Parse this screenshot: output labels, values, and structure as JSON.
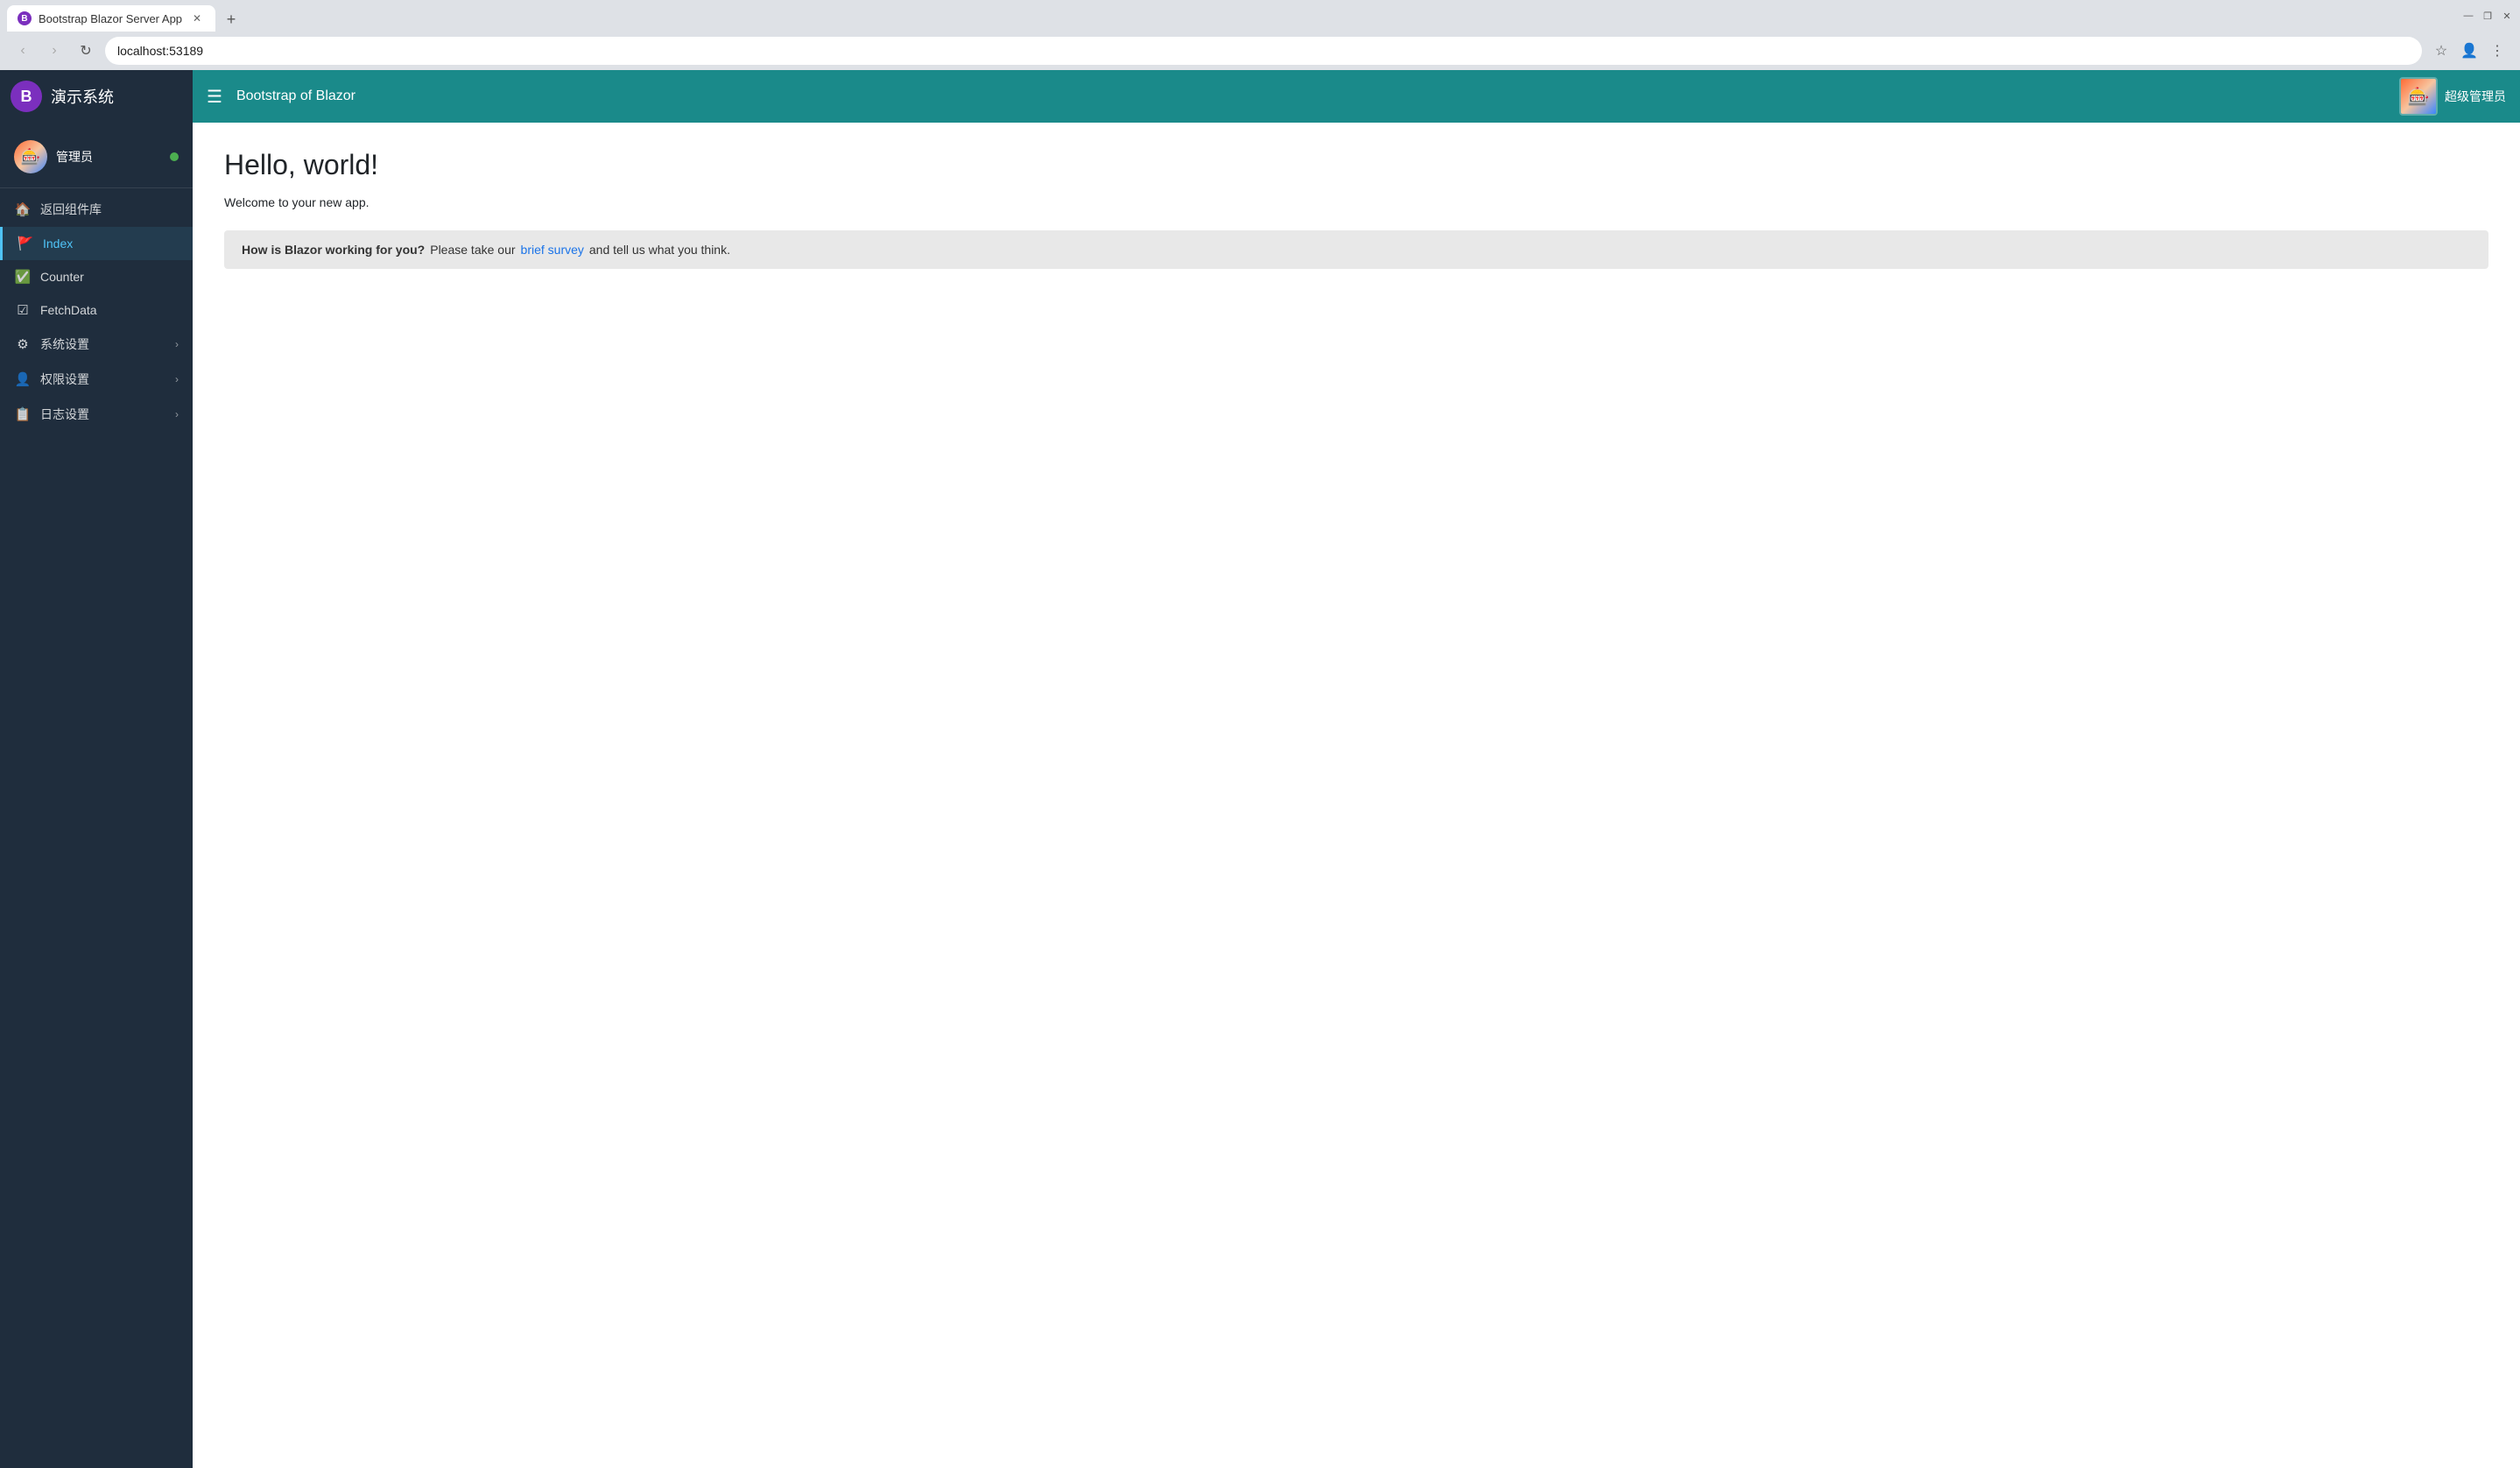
{
  "browser": {
    "tab": {
      "title": "Bootstrap Blazor Server App",
      "favicon": "B"
    },
    "new_tab_label": "+",
    "address": "localhost:53189",
    "window_controls": {
      "minimize": "—",
      "maximize": "❐",
      "close": "✕"
    }
  },
  "header": {
    "brand_logo": "B",
    "brand_name": "演示系统",
    "toggle_icon": "☰",
    "title": "Bootstrap of Blazor",
    "avatar_emoji": "🎰",
    "username": "超级管理员"
  },
  "sidebar": {
    "user": {
      "avatar_emoji": "🎰",
      "name": "管理员",
      "status_dot_color": "#4caf50"
    },
    "items": [
      {
        "id": "back",
        "icon": "🏠",
        "label": "返回组件库",
        "active": false,
        "submenu": false
      },
      {
        "id": "index",
        "icon": "🚩",
        "label": "Index",
        "active": true,
        "submenu": false
      },
      {
        "id": "counter",
        "icon": "✅",
        "label": "Counter",
        "active": false,
        "submenu": false
      },
      {
        "id": "fetchdata",
        "icon": "☑",
        "label": "FetchData",
        "active": false,
        "submenu": false
      },
      {
        "id": "system-settings",
        "icon": "⚙",
        "label": "系统设置",
        "active": false,
        "submenu": true
      },
      {
        "id": "permissions",
        "icon": "👤",
        "label": "权限设置",
        "active": false,
        "submenu": true
      },
      {
        "id": "log-settings",
        "icon": "📋",
        "label": "日志设置",
        "active": false,
        "submenu": true
      }
    ]
  },
  "main": {
    "page_title": "Hello, world!",
    "page_subtitle": "Welcome to your new app.",
    "alert": {
      "bold_text": "How is Blazor working for you?",
      "text": " Please take our ",
      "link_text": "brief survey",
      "after_link": " and tell us what you think."
    }
  }
}
